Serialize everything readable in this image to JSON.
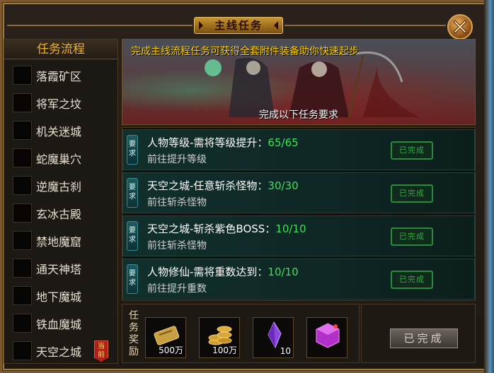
{
  "window": {
    "title": "主线任务"
  },
  "sidebar": {
    "header": "任务流程",
    "items": [
      {
        "label": "落霞矿区"
      },
      {
        "label": "将军之坟"
      },
      {
        "label": "机关迷城"
      },
      {
        "label": "蛇魔巢穴"
      },
      {
        "label": "逆魔古刹"
      },
      {
        "label": "玄冰古殿"
      },
      {
        "label": "禁地魔窟"
      },
      {
        "label": "通天神塔"
      },
      {
        "label": "地下魔城"
      },
      {
        "label": "铁血魔城"
      },
      {
        "label": "天空之城",
        "badge": "当前"
      }
    ]
  },
  "banner": {
    "headline": "完成主线流程任务可获得全套附件装备助你快速起步",
    "subtitle": "完成以下任务要求"
  },
  "tasks": [
    {
      "badge": "要求",
      "title": "人物等级-需将等级提升：",
      "progress": "65/65",
      "desc": "前往提升等级",
      "stamp": "已完成"
    },
    {
      "badge": "要求",
      "title": "天空之城-任意斩杀怪物：",
      "progress": "30/30",
      "desc": "前往斩杀怪物",
      "stamp": "已完成"
    },
    {
      "badge": "要求",
      "title": "天空之城-斩杀紫色BOSS：",
      "progress": "10/10",
      "desc": "前往斩杀怪物",
      "stamp": "已完成"
    },
    {
      "badge": "要求",
      "title": "人物修仙-需将重数达到：",
      "progress": "10/10",
      "desc": "前往提升重数",
      "stamp": "已完成"
    }
  ],
  "rewards": {
    "label": "任务奖励",
    "items": [
      {
        "icon": "gold-ingot-icon",
        "qty": "500万"
      },
      {
        "icon": "coin-stack-icon",
        "qty": "100万"
      },
      {
        "icon": "purple-crystal-icon",
        "qty": "10"
      },
      {
        "icon": "purple-gem-box-icon",
        "qty": ""
      }
    ]
  },
  "done_button": "已完成",
  "colors": {
    "progress_green": "#3ee05a",
    "headline_yellow": "#ffd000",
    "sidebar_header": "#f0b030",
    "current_badge": "#b0201a"
  }
}
